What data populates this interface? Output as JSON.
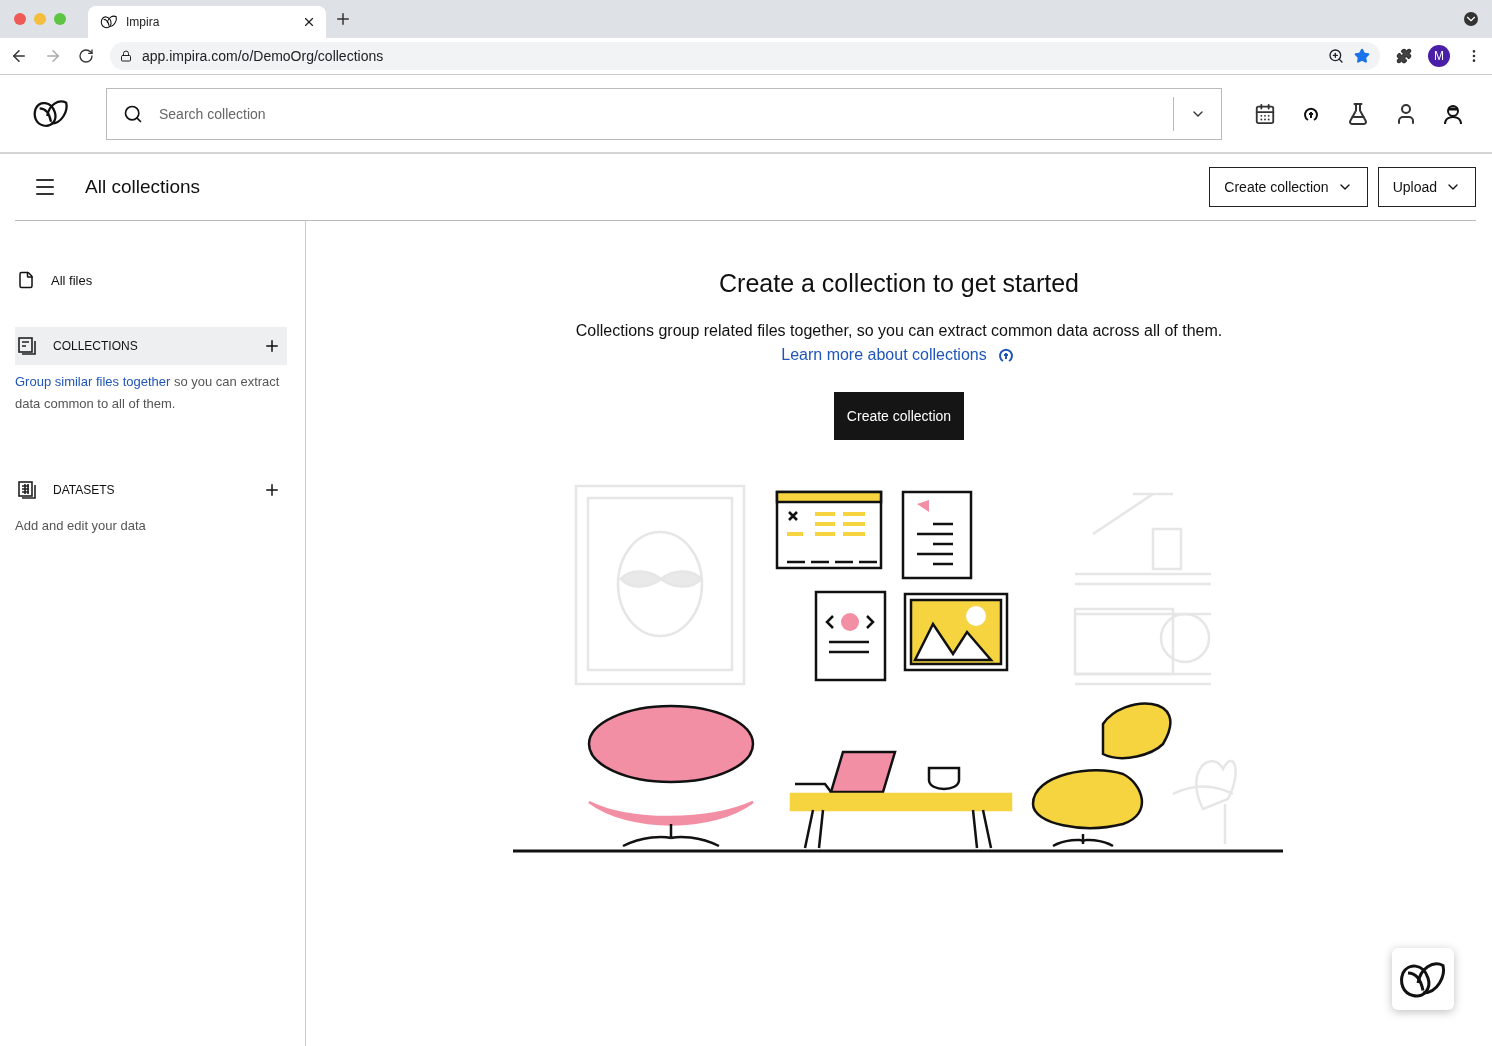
{
  "browser": {
    "tab_title": "Impira",
    "url": "app.impira.com/o/DemoOrg/collections",
    "profile_initial": "M",
    "bookmarked": true
  },
  "search": {
    "placeholder": "Search collection"
  },
  "page": {
    "title": "All collections",
    "buttons": [
      {
        "label": "Create collection"
      },
      {
        "label": "Upload"
      }
    ]
  },
  "sidebar": {
    "all_files": "All files",
    "sections": [
      {
        "kind": "collections",
        "label": "COLLECTIONS",
        "selected": true,
        "link": "Group similar files together",
        "rest": " so you can extract data common to all of them."
      },
      {
        "kind": "datasets",
        "label": "DATASETS",
        "selected": false,
        "rest": "Add and edit your data"
      }
    ]
  },
  "empty_state": {
    "heading": "Create a collection to get started",
    "body": "Collections group related files together, so you can extract common data across all of them.",
    "link": "Learn more about collections",
    "button": "Create collection"
  }
}
